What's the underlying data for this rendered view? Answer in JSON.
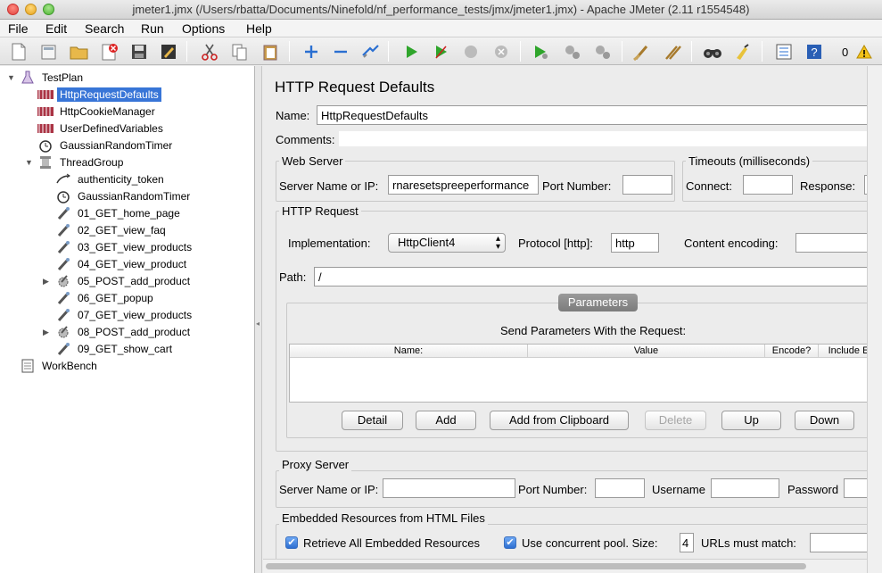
{
  "window": {
    "title": "jmeter1.jmx (/Users/rbatta/Documents/Ninefold/nf_performance_tests/jmx/jmeter1.jmx) - Apache JMeter (2.11 r1554548)"
  },
  "menu": [
    "File",
    "Edit",
    "Search",
    "Run",
    "Options",
    "Help"
  ],
  "toolbar": {
    "error_count": "0"
  },
  "tree": [
    {
      "label": "TestPlan",
      "icon": "flask-icon"
    },
    {
      "label": "HttpRequestDefaults",
      "icon": "config-element-icon"
    },
    {
      "label": "HttpCookieManager",
      "icon": "config-element-icon"
    },
    {
      "label": "UserDefinedVariables",
      "icon": "config-element-icon"
    },
    {
      "label": "GaussianRandomTimer",
      "icon": "timer-icon"
    },
    {
      "label": "ThreadGroup",
      "icon": "spool-icon"
    },
    {
      "label": "authenticity_token",
      "icon": "extractor-icon"
    },
    {
      "label": "GaussianRandomTimer",
      "icon": "timer-icon"
    },
    {
      "label": "01_GET_home_page",
      "icon": "sampler-icon"
    },
    {
      "label": "02_GET_view_faq",
      "icon": "sampler-icon"
    },
    {
      "label": "03_GET_view_products",
      "icon": "sampler-icon"
    },
    {
      "label": "04_GET_view_product",
      "icon": "sampler-icon"
    },
    {
      "label": "05_POST_add_product",
      "icon": "sampler-icon"
    },
    {
      "label": "06_GET_popup",
      "icon": "sampler-icon"
    },
    {
      "label": "07_GET_view_products",
      "icon": "sampler-icon"
    },
    {
      "label": "08_POST_add_product",
      "icon": "sampler-icon"
    },
    {
      "label": "09_GET_show_cart",
      "icon": "sampler-icon"
    },
    {
      "label": "WorkBench",
      "icon": "workbench-icon"
    }
  ],
  "panel": {
    "title": "HTTP Request Defaults",
    "name_label": "Name:",
    "name_value": "HttpRequestDefaults",
    "comments_label": "Comments:",
    "web_server": {
      "title": "Web Server",
      "server_label": "Server Name or IP:",
      "server_value": "rnaresetspreeperformance",
      "port_label": "Port Number:"
    },
    "timeouts": {
      "title": "Timeouts (milliseconds)",
      "connect_label": "Connect:",
      "response_label": "Response:"
    },
    "http_request": {
      "title": "HTTP Request",
      "implementation_label": "Implementation:",
      "implementation_value": "HttpClient4",
      "protocol_label": "Protocol [http]:",
      "protocol_value": "http",
      "encoding_label": "Content encoding:",
      "path_label": "Path:",
      "path_value": "/"
    },
    "parameters": {
      "tab": "Parameters",
      "caption": "Send Parameters With the Request:",
      "columns": [
        "Name:",
        "Value",
        "Encode?",
        "Include E"
      ],
      "buttons": {
        "detail": "Detail",
        "add": "Add",
        "add_clipboard": "Add from Clipboard",
        "delete": "Delete",
        "up": "Up",
        "down": "Down"
      }
    },
    "proxy": {
      "title": "Proxy Server",
      "server_label": "Server Name or IP:",
      "port_label": "Port Number:",
      "username_label": "Username",
      "password_label": "Password"
    },
    "embedded": {
      "title": "Embedded Resources from HTML Files",
      "retrieve_label": "Retrieve All Embedded Resources",
      "concurrent_label": "Use concurrent pool. Size:",
      "pool_size": "4",
      "urls_label": "URLs must match:"
    }
  }
}
